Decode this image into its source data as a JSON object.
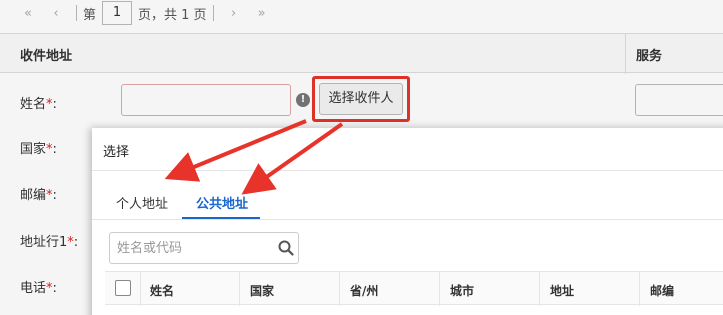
{
  "pager": {
    "first_icon": "«",
    "prev_icon": "‹",
    "page_prefix": "第",
    "current_page": "1",
    "page_suffix": "页，共 1 页",
    "next_icon": "›",
    "last_icon": "»"
  },
  "section": {
    "title": "收件地址",
    "service_title": "服务"
  },
  "form": {
    "name_label": "姓名",
    "country_label": "国家",
    "zip_label": "邮编",
    "address1_label": "地址行1",
    "phone_label": "电话",
    "required_mark": "*",
    "label_colon": ":",
    "warn_icon_text": "!",
    "choose_button": "选择收件人"
  },
  "modal": {
    "title": "选择",
    "tabs": [
      {
        "label": "个人地址",
        "active": false
      },
      {
        "label": "公共地址",
        "active": true
      }
    ],
    "search_placeholder": "姓名或代码",
    "columns": [
      "姓名",
      "国家",
      "省/州",
      "城市",
      "地址",
      "邮编"
    ]
  },
  "colors": {
    "accent": "#1a66cc",
    "annotation": "#e8332a",
    "required": "#e02020"
  },
  "icons": {
    "first": "double-chevron-left-icon",
    "prev": "chevron-left-icon",
    "next": "chevron-right-icon",
    "last": "double-chevron-right-icon",
    "search": "search-icon",
    "warning": "warning-icon"
  }
}
